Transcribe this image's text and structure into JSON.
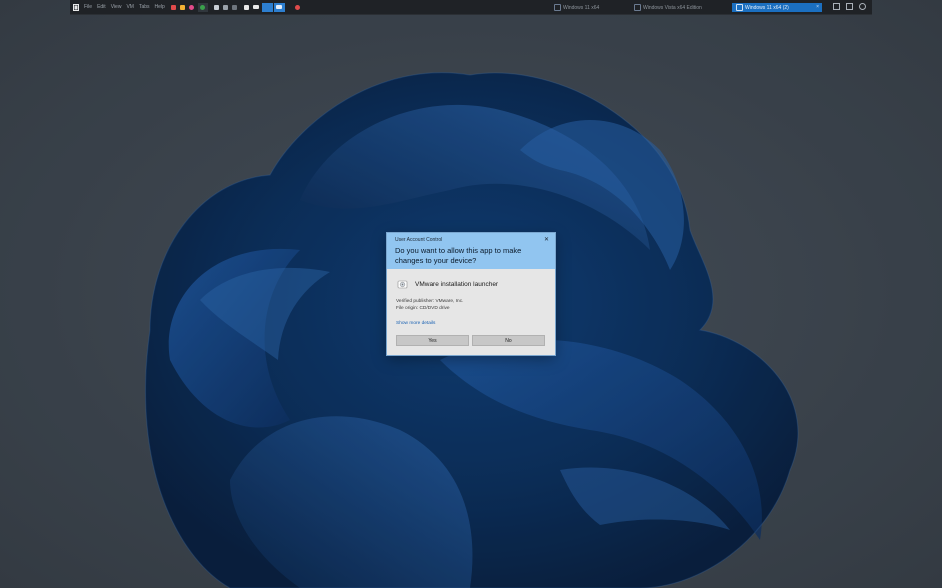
{
  "toolbar": {
    "menus": [
      "File",
      "Edit",
      "View",
      "VM",
      "Tabs",
      "Help"
    ],
    "vm_tabs": [
      {
        "label": "Windows 11 x64",
        "active": false
      },
      {
        "label": "Windows Vista x64 Edition",
        "active": false
      },
      {
        "label": "Windows 11 x64 (2)",
        "active": true
      }
    ]
  },
  "uac": {
    "title": "User Account Control",
    "close_glyph": "✕",
    "question": "Do you want to allow this app to make changes to your device?",
    "app_name": "VMware installation launcher",
    "publisher": "Verified publisher: VMware, Inc.",
    "origin": "File origin: CD/DVD drive",
    "more_details": "Show more details",
    "yes_label": "Yes",
    "no_label": "No"
  },
  "colors": {
    "uac_header": "#91c5f0",
    "uac_body": "#e6e6e6",
    "active_tab": "#1b6fc0",
    "link": "#1a62b3"
  },
  "icons": [
    "vmware-icon",
    "shield-icon",
    "power-icon",
    "snapshot-icon",
    "fullscreen-icon",
    "console-icon"
  ]
}
